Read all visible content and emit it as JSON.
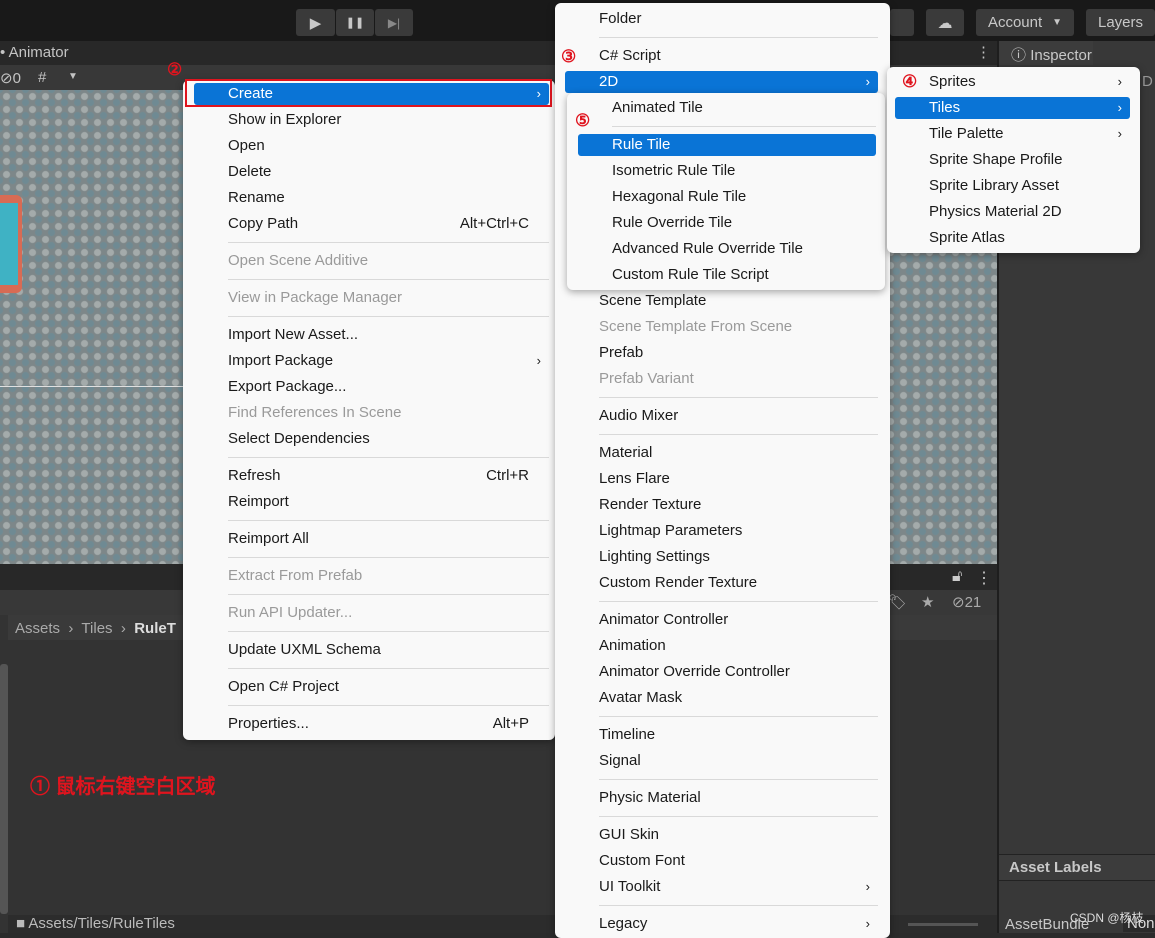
{
  "toolbar": {
    "play_icon": "▶",
    "pause_icon": "❚❚",
    "step_icon": "▶|",
    "account": "Account",
    "layers": "Layers"
  },
  "scene": {
    "tab_title": "Animator",
    "hidden_count": "0"
  },
  "inspector": {
    "tab_title": "Inspector",
    "asset_labels": "Asset Labels",
    "asset_bundle_label": "AssetBundle",
    "asset_bundle_value": "None",
    "partial_label": "D"
  },
  "project": {
    "breadcrumb": [
      "Assets",
      "Tiles",
      "RuleT"
    ],
    "hidden_count": "21",
    "footer_path": "Assets/Tiles/RuleTiles"
  },
  "annotations": {
    "a1": "① 鼠标右键空白区域",
    "a2": "②",
    "a3": "③",
    "a4": "④",
    "a5": "⑤"
  },
  "watermark": "CSDN @杨枝",
  "accent": "#0a74d6",
  "menu_context": [
    {
      "label": "Create",
      "hl": true,
      "arrow": true
    },
    {
      "label": "Show in Explorer"
    },
    {
      "label": "Open"
    },
    {
      "label": "Delete"
    },
    {
      "label": "Rename"
    },
    {
      "label": "Copy Path",
      "shortcut": "Alt+Ctrl+C"
    },
    {
      "sep": true
    },
    {
      "label": "Open Scene Additive",
      "dis": true
    },
    {
      "sep": true
    },
    {
      "label": "View in Package Manager",
      "dis": true
    },
    {
      "sep": true
    },
    {
      "label": "Import New Asset..."
    },
    {
      "label": "Import Package",
      "arrow": true
    },
    {
      "label": "Export Package..."
    },
    {
      "label": "Find References In Scene",
      "dis": true
    },
    {
      "label": "Select Dependencies"
    },
    {
      "sep": true
    },
    {
      "label": "Refresh",
      "shortcut": "Ctrl+R"
    },
    {
      "label": "Reimport"
    },
    {
      "sep": true
    },
    {
      "label": "Reimport All"
    },
    {
      "sep": true
    },
    {
      "label": "Extract From Prefab",
      "dis": true
    },
    {
      "sep": true
    },
    {
      "label": "Run API Updater...",
      "dis": true
    },
    {
      "sep": true
    },
    {
      "label": "Update UXML Schema"
    },
    {
      "sep": true
    },
    {
      "label": "Open C# Project"
    },
    {
      "sep": true
    },
    {
      "label": "Properties...",
      "shortcut": "Alt+P"
    }
  ],
  "menu_create_top": [
    {
      "label": "Folder"
    },
    {
      "sep": true
    },
    {
      "label": "C# Script"
    },
    {
      "label": "2D",
      "hl": true,
      "arrow": true
    }
  ],
  "menu_create_bottom": [
    {
      "label": "Scene Template"
    },
    {
      "label": "Scene Template From Scene",
      "dis": true
    },
    {
      "label": "Prefab"
    },
    {
      "label": "Prefab Variant",
      "dis": true
    },
    {
      "sep": true
    },
    {
      "label": "Audio Mixer"
    },
    {
      "sep": true
    },
    {
      "label": "Material"
    },
    {
      "label": "Lens Flare"
    },
    {
      "label": "Render Texture"
    },
    {
      "label": "Lightmap Parameters"
    },
    {
      "label": "Lighting Settings"
    },
    {
      "label": "Custom Render Texture"
    },
    {
      "sep": true
    },
    {
      "label": "Animator Controller"
    },
    {
      "label": "Animation"
    },
    {
      "label": "Animator Override Controller"
    },
    {
      "label": "Avatar Mask"
    },
    {
      "sep": true
    },
    {
      "label": "Timeline"
    },
    {
      "label": "Signal"
    },
    {
      "sep": true
    },
    {
      "label": "Physic Material"
    },
    {
      "sep": true
    },
    {
      "label": "GUI Skin"
    },
    {
      "label": "Custom Font"
    },
    {
      "label": "UI Toolkit",
      "arrow": true
    },
    {
      "sep": true
    },
    {
      "label": "Legacy",
      "arrow": true
    }
  ],
  "menu_2d": [
    {
      "label": "Animated Tile"
    },
    {
      "sep": true
    },
    {
      "label": "Rule Tile",
      "hl": true
    },
    {
      "label": "Isometric Rule Tile"
    },
    {
      "label": "Hexagonal Rule Tile"
    },
    {
      "label": "Rule Override Tile"
    },
    {
      "label": "Advanced Rule Override Tile"
    },
    {
      "label": "Custom Rule Tile Script"
    }
  ],
  "menu_2d_root": [
    {
      "label": "Sprites",
      "arrow": true
    },
    {
      "label": "Tiles",
      "hl": true,
      "arrow": true
    },
    {
      "label": "Tile Palette",
      "arrow": true
    },
    {
      "label": "Sprite Shape Profile"
    },
    {
      "label": "Sprite Library Asset"
    },
    {
      "label": "Physics Material 2D"
    },
    {
      "label": "Sprite Atlas"
    }
  ]
}
